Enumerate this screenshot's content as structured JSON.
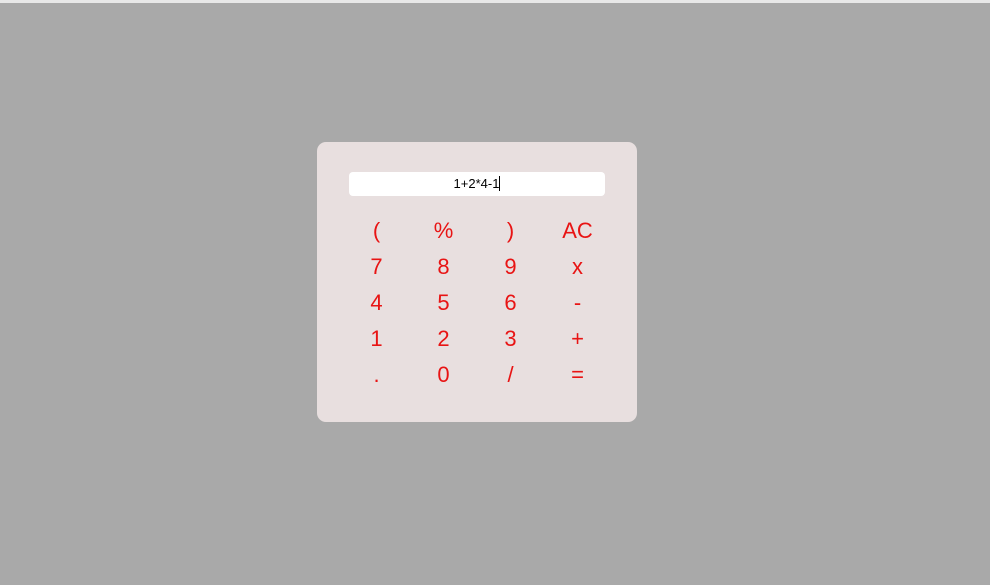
{
  "display": {
    "value": "1+2*4-1"
  },
  "keys": [
    "(",
    "%",
    ")",
    "AC",
    "7",
    "8",
    "9",
    "x",
    "4",
    "5",
    "6",
    "-",
    "1",
    "2",
    "3",
    "+",
    ".",
    "0",
    "/",
    "="
  ],
  "colors": {
    "background": "#a9a9a9",
    "card": "#e8dfdf",
    "key_text": "#e81414"
  }
}
